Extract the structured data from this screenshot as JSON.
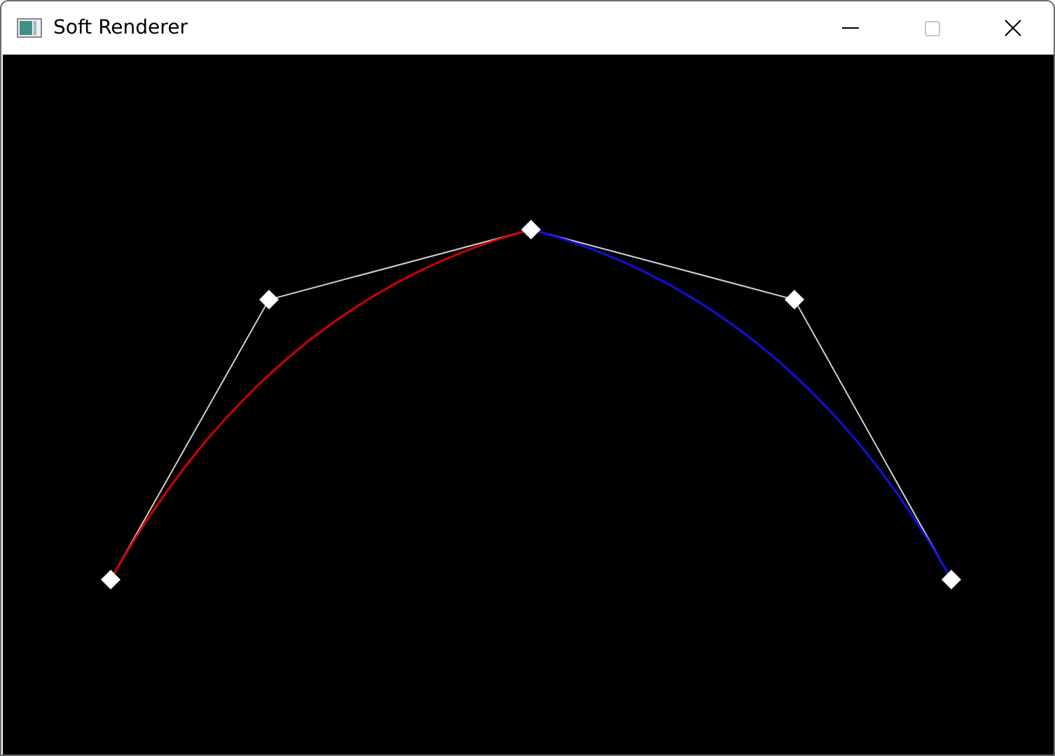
{
  "window": {
    "title": "Soft Renderer",
    "maximize_disabled": true
  }
}
